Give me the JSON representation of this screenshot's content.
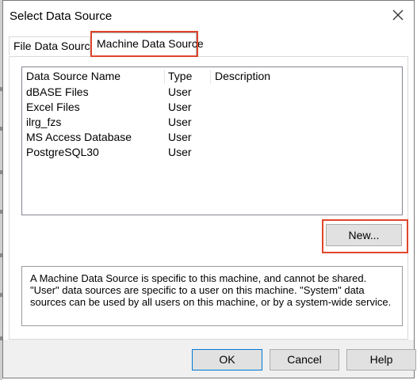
{
  "dialog": {
    "title": "Select Data Source",
    "close_icon": "close-icon"
  },
  "tabs": [
    {
      "label": "File Data Source",
      "active": false
    },
    {
      "label": "Machine Data Source",
      "active": true
    }
  ],
  "table": {
    "columns": [
      "Data Source Name",
      "Type",
      "Description"
    ],
    "rows": [
      {
        "name": "dBASE Files",
        "type": "User",
        "description": ""
      },
      {
        "name": "Excel Files",
        "type": "User",
        "description": ""
      },
      {
        "name": "ilrg_fzs",
        "type": "User",
        "description": ""
      },
      {
        "name": "MS Access Database",
        "type": "User",
        "description": ""
      },
      {
        "name": "PostgreSQL30",
        "type": "User",
        "description": ""
      }
    ]
  },
  "new_button": "New...",
  "description_text": "A Machine Data Source is specific to this machine, and cannot be shared.  \"User\" data sources are specific to a user on this machine.  \"System\" data sources can be used by all users on this machine, or by a system-wide service.",
  "footer": {
    "ok": "OK",
    "cancel": "Cancel",
    "help": "Help"
  },
  "colors": {
    "highlight": "#e0452b",
    "footer_bg": "#f0f0f0",
    "button_bg": "#e1e1e1",
    "default_button_border": "#0078d7"
  }
}
